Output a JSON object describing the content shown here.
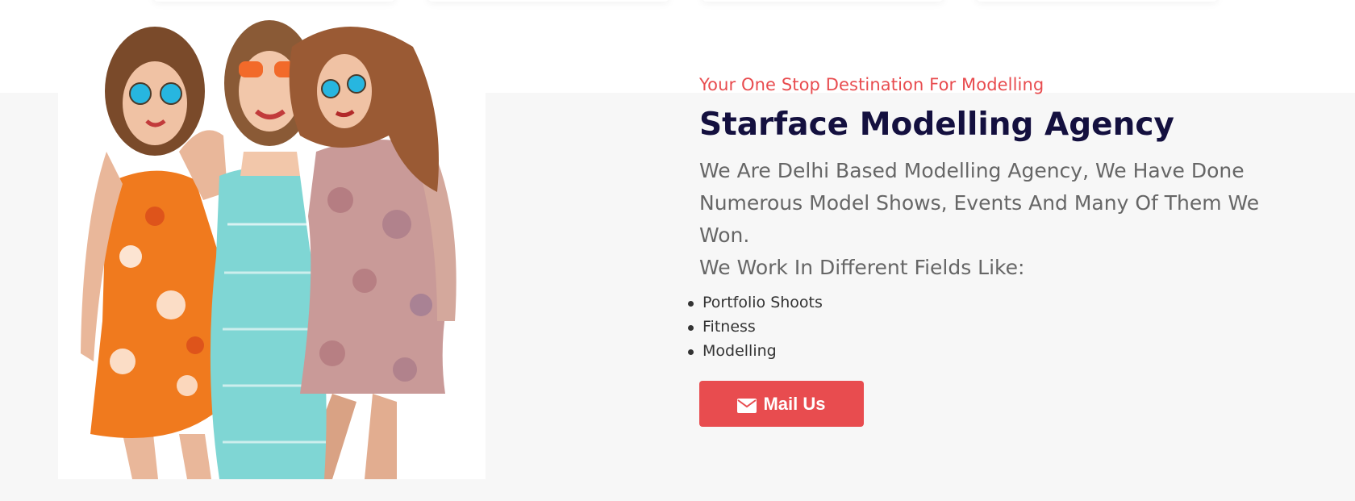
{
  "hero": {
    "tagline": "Your One Stop Destination For Modelling",
    "title": "Starface Modelling Agency",
    "description": "We Are Delhi Based Modelling Agency, We Have Done Numerous Model Shows, Events And Many Of Them We Won.",
    "fields_label": "We Work In Different Fields Like:",
    "fields": [
      "Portfolio Shoots",
      "Fitness",
      "Modelling"
    ],
    "cta_label": "Mail Us",
    "cta_icon": "envelope-icon",
    "image_alt": "three-models-photo"
  },
  "colors": {
    "accent": "#e84c4f",
    "title": "#14103f",
    "body_text": "#666666",
    "band": "#f7f7f7"
  }
}
